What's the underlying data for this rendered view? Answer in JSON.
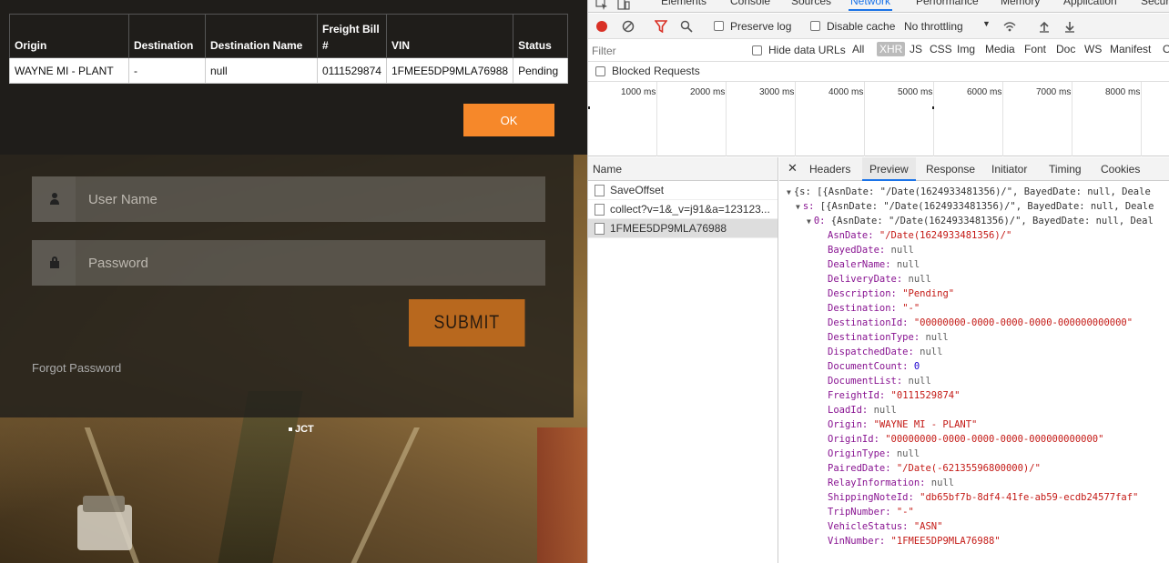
{
  "site": {
    "table_headers": [
      "Origin",
      "Destination",
      "Destination Name",
      "Freight Bill #",
      "VIN",
      "Status"
    ],
    "table_rows": [
      [
        "WAYNE MI - PLANT",
        "-",
        "null",
        "0111529874",
        "1FMEE5DP9MLA76988",
        "Pending"
      ]
    ],
    "ok_label": "OK",
    "username_placeholder": "User Name",
    "password_placeholder": "Password",
    "submit_label": "SUBMIT",
    "forgot_label": "Forgot Password",
    "brand": "JCT",
    "accent_color": "#f6882a"
  },
  "devtools": {
    "main_tabs": [
      "Elements",
      "Console",
      "Sources",
      "Network",
      "Performance",
      "Memory",
      "Application",
      "Secur"
    ],
    "active_tab": "Network",
    "preserve_log": "Preserve log",
    "disable_cache": "Disable cache",
    "throttling": "No throttling",
    "filter_placeholder": "Filter",
    "hide_data_urls": "Hide data URLs",
    "filter_types": [
      "All",
      "XHR",
      "JS",
      "CSS",
      "Img",
      "Media",
      "Font",
      "Doc",
      "WS",
      "Manifest",
      "O"
    ],
    "active_filter": "XHR",
    "blocked_requests": "Blocked Requests",
    "timeline_labels": [
      "1000 ms",
      "2000 ms",
      "3000 ms",
      "4000 ms",
      "5000 ms",
      "6000 ms",
      "7000 ms",
      "8000 ms"
    ],
    "name_header": "Name",
    "requests": [
      "SaveOffset",
      "collect?v=1&_v=j91&a=123123...",
      "1FMEE5DP9MLA76988"
    ],
    "detail_tabs": [
      "Headers",
      "Preview",
      "Response",
      "Initiator",
      "Timing",
      "Cookies"
    ],
    "active_detail_tab": "Preview",
    "preview_lines": [
      {
        "indent": 0,
        "tri": true,
        "key": "",
        "text": "{s: [{AsnDate: \"/Date(1624933481356)/\", BayedDate: null, Deale"
      },
      {
        "indent": 1,
        "tri": true,
        "key": "s:",
        "text": " [{AsnDate: \"/Date(1624933481356)/\", BayedDate: null, Deale"
      },
      {
        "indent": 2,
        "tri": true,
        "key": "0:",
        "text": " {AsnDate: \"/Date(1624933481356)/\", BayedDate: null, Deal"
      },
      {
        "indent": 3,
        "key": "AsnDate:",
        "val": "\"/Date(1624933481356)/\"",
        "type": "s"
      },
      {
        "indent": 3,
        "key": "BayedDate:",
        "val": "null",
        "type": "nl"
      },
      {
        "indent": 3,
        "key": "DealerName:",
        "val": "null",
        "type": "nl"
      },
      {
        "indent": 3,
        "key": "DeliveryDate:",
        "val": "null",
        "type": "nl"
      },
      {
        "indent": 3,
        "key": "Description:",
        "val": "\"Pending\"",
        "type": "s"
      },
      {
        "indent": 3,
        "key": "Destination:",
        "val": "\"-\"",
        "type": "s"
      },
      {
        "indent": 3,
        "key": "DestinationId:",
        "val": "\"00000000-0000-0000-0000-000000000000\"",
        "type": "s"
      },
      {
        "indent": 3,
        "key": "DestinationType:",
        "val": "null",
        "type": "nl"
      },
      {
        "indent": 3,
        "key": "DispatchedDate:",
        "val": "null",
        "type": "nl"
      },
      {
        "indent": 3,
        "key": "DocumentCount:",
        "val": "0",
        "type": "n"
      },
      {
        "indent": 3,
        "key": "DocumentList:",
        "val": "null",
        "type": "nl"
      },
      {
        "indent": 3,
        "key": "FreightId:",
        "val": "\"0111529874\"",
        "type": "s"
      },
      {
        "indent": 3,
        "key": "LoadId:",
        "val": "null",
        "type": "nl"
      },
      {
        "indent": 3,
        "key": "Origin:",
        "val": "\"WAYNE MI - PLANT\"",
        "type": "s"
      },
      {
        "indent": 3,
        "key": "OriginId:",
        "val": "\"00000000-0000-0000-0000-000000000000\"",
        "type": "s"
      },
      {
        "indent": 3,
        "key": "OriginType:",
        "val": "null",
        "type": "nl"
      },
      {
        "indent": 3,
        "key": "PairedDate:",
        "val": "\"/Date(-62135596800000)/\"",
        "type": "s"
      },
      {
        "indent": 3,
        "key": "RelayInformation:",
        "val": "null",
        "type": "nl"
      },
      {
        "indent": 3,
        "key": "ShippingNoteId:",
        "val": "\"db65bf7b-8df4-41fe-ab59-ecdb24577faf\"",
        "type": "s"
      },
      {
        "indent": 3,
        "key": "TripNumber:",
        "val": "\"-\"",
        "type": "s"
      },
      {
        "indent": 3,
        "key": "VehicleStatus:",
        "val": "\"ASN\"",
        "type": "s"
      },
      {
        "indent": 3,
        "key": "VinNumber:",
        "val": "\"1FMEE5DP9MLA76988\"",
        "type": "s"
      }
    ]
  }
}
